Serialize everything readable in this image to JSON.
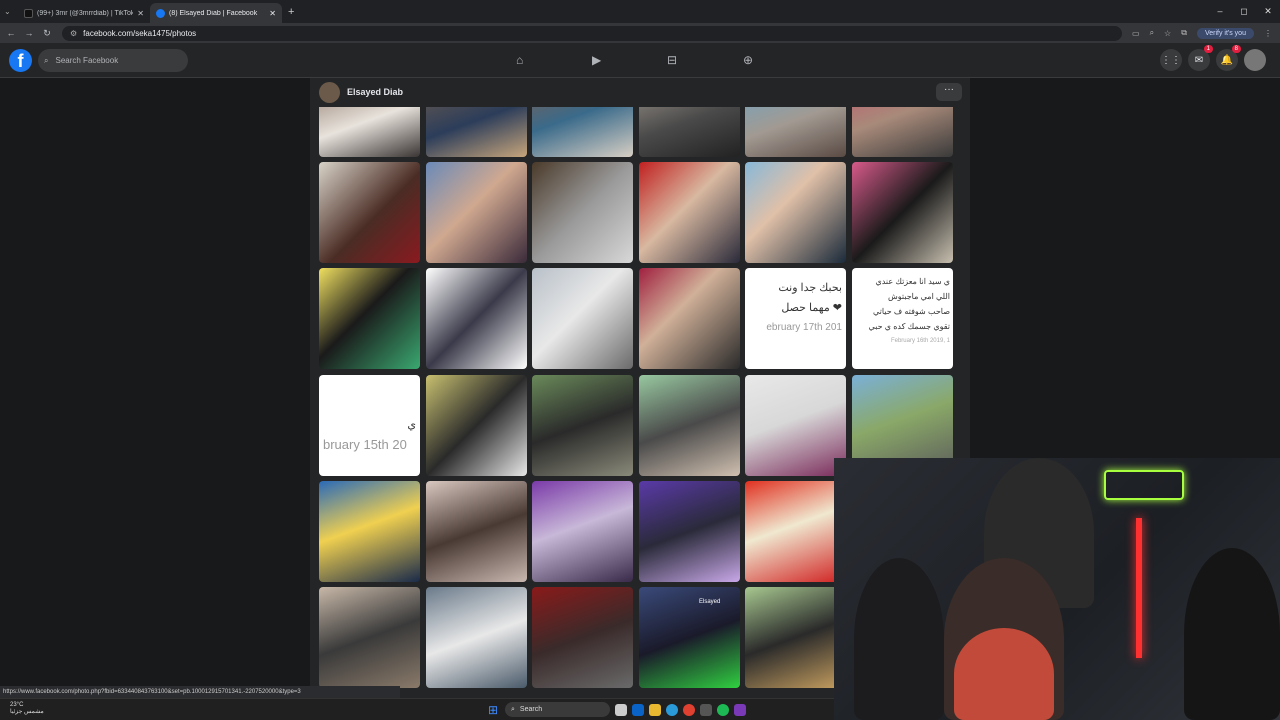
{
  "browser": {
    "tabs": [
      {
        "title": "(99+) 3mr (@3mrrdiab) | TikTok",
        "active": false
      },
      {
        "title": "(8) Elsayed Diab | Facebook",
        "active": true
      }
    ],
    "url": "facebook.com/seka1475/photos",
    "verify_label": "Verify it's you"
  },
  "facebook": {
    "search_placeholder": "Search Facebook",
    "logo": "f",
    "messenger_badge": "1",
    "notifications_badge": "8"
  },
  "profile": {
    "name": "Elsayed Diab",
    "more": "···"
  },
  "text_photos": {
    "p1_line1": "بحبك جدا ونت",
    "p1_line2": "مهما حصل ❤",
    "p1_date": "ebruary 17th 201",
    "p2_line1": "ي سيد انا معزتك عندي",
    "p2_line2": "اللي امي ماجبتوش",
    "p2_line3": "صاحب شوفته ف حياتي",
    "p2_line4": "تقوي جسمك كده ي حبي",
    "p2_date": "February 16th 2019, 1",
    "p3_line1": "ي",
    "p3_date": "bruary 15th 20",
    "p4_label": "Elsayed"
  },
  "status_url": "https://www.facebook.com/photo.php?fbid=633440843763100&set=pb.100012915701341.-2207520000&type=3",
  "taskbar": {
    "temp": "23°C",
    "weather": "مشمس جزئيا",
    "search": "Search"
  },
  "colors": {
    "fb_blue": "#1877f2",
    "bg": "#18191a",
    "surface": "#242526"
  }
}
